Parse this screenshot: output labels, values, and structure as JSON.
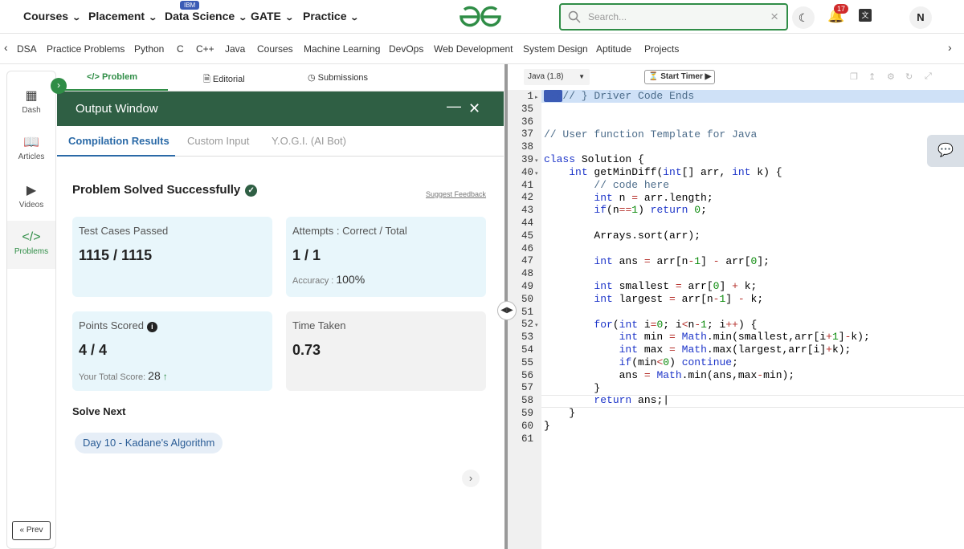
{
  "topnav": {
    "items": [
      "Courses",
      "Placement",
      "Data Science",
      "GATE",
      "Practice"
    ],
    "ibm_badge": "IBM",
    "search_placeholder": "Search...",
    "notification_count": "17",
    "avatar_initial": "N"
  },
  "subnav": {
    "items": [
      "DSA",
      "Practice Problems",
      "Python",
      "C",
      "C++",
      "Java",
      "Courses",
      "Machine Learning",
      "DevOps",
      "Web Development",
      "System Design",
      "Aptitude",
      "Projects"
    ]
  },
  "sidebar": {
    "items": [
      "Dash",
      "Articles",
      "Videos",
      "Problems"
    ],
    "prev_label": "Prev"
  },
  "problem_tabs": [
    "Problem",
    "Editorial",
    "Submissions"
  ],
  "output_window": {
    "title": "Output Window",
    "tabs": [
      "Compilation Results",
      "Custom Input",
      "Y.O.G.I. (AI Bot)"
    ],
    "status": "Problem Solved Successfully",
    "suggest_feedback": "Suggest Feedback",
    "cards": {
      "test_cases_label": "Test Cases Passed",
      "test_cases_value": "1115 / 1115",
      "attempts_label": "Attempts : Correct / Total",
      "attempts_value": "1 / 1",
      "accuracy_label": "Accuracy :",
      "accuracy_value": "100%",
      "points_label": "Points Scored",
      "points_value": "4 / 4",
      "total_score_label": "Your Total Score:",
      "total_score_value": "28",
      "time_label": "Time Taken",
      "time_value": "0.73"
    },
    "solve_next_label": "Solve Next",
    "next_problem": "Day 10 - Kadane's Algorithm"
  },
  "editor": {
    "language": "Java (1.8)",
    "timer_label": "Start Timer",
    "line_numbers": [
      "1",
      "35",
      "36",
      "37",
      "38",
      "39",
      "40",
      "41",
      "42",
      "43",
      "44",
      "45",
      "46",
      "47",
      "48",
      "49",
      "50",
      "51",
      "52",
      "53",
      "54",
      "55",
      "56",
      "57",
      "58",
      "59",
      "60",
      "61"
    ]
  }
}
